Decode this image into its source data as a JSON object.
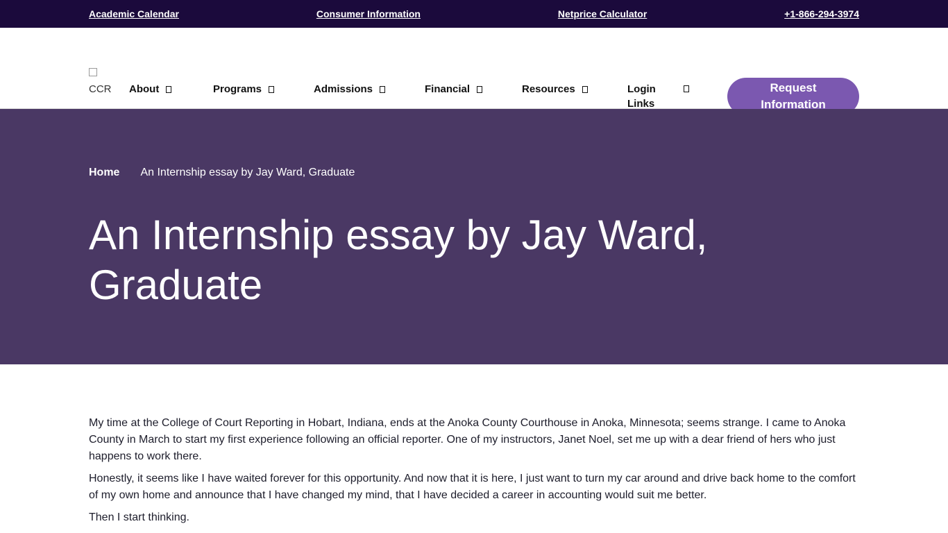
{
  "topbar": {
    "links": [
      "Academic Calendar",
      "Consumer Information ",
      "Netprice Calculator",
      "+1-866-294-3974"
    ]
  },
  "header": {
    "logo_alt": "CCR",
    "nav": [
      "About",
      "Programs",
      "Admissions",
      "Financial",
      "Resources"
    ],
    "login_line1": "Login",
    "login_line2": "Links",
    "request_button": "Request Information"
  },
  "hero": {
    "breadcrumb_home": "Home",
    "breadcrumb_current": "An Internship essay by Jay Ward, Graduate",
    "title": "An Internship essay by Jay Ward, Graduate"
  },
  "article": {
    "paragraphs": [
      "My time at the College of Court Reporting in Hobart, Indiana, ends at the Anoka County Courthouse in Anoka, Minnesota; seems strange. I came to Anoka County in March to start my first experience following an official reporter. One of my instructors, Janet Noel, set me up with a dear friend of hers who just happens to work there.",
      "Honestly, it seems like I have waited forever for this opportunity. And now that it is here, I just want to turn my car around and drive back home to the comfort of my own home and announce that I have changed my mind, that I have decided a career in accounting would suit me better.",
      "Then I start thinking."
    ]
  },
  "colors": {
    "topbar_bg": "#1b0a3c",
    "hero_bg": "#4a3864",
    "button_bg": "#7b58b0"
  }
}
